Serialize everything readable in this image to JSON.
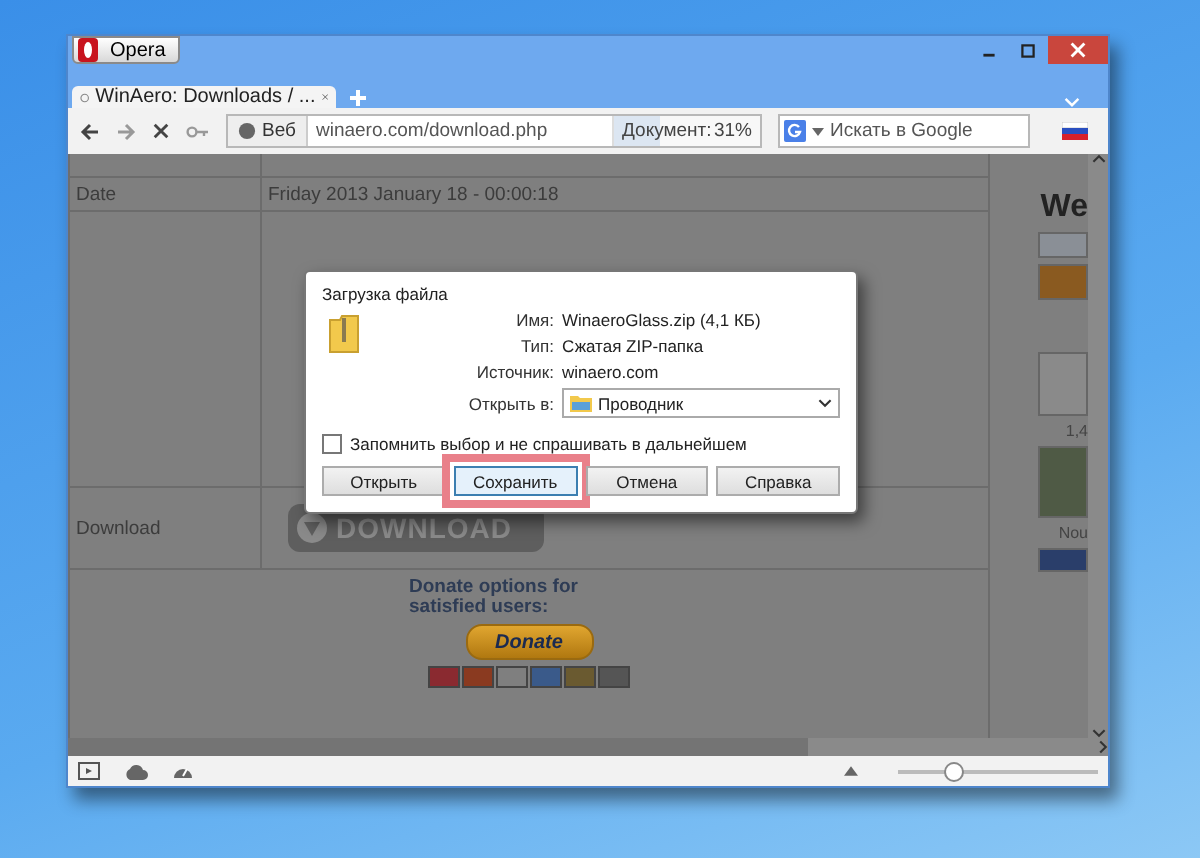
{
  "window": {
    "menu_button": "Opera"
  },
  "tabs": [
    {
      "label": "WinAero: Downloads / ...",
      "selected": true
    }
  ],
  "toolbar": {
    "address_badge": "Веб",
    "url": "winaero.com/download.php",
    "progress_label": "Документ:",
    "progress_reading": "31%",
    "progress": {
      "level": 0.31
    },
    "search": {
      "placeholder": "Искать в Google"
    }
  },
  "page": {
    "rows": [
      {
        "label": "Date",
        "value": "Friday 2013 January 18 - 00:00:18"
      },
      {
        "label": "Download",
        "button": "DOWNLOAD"
      }
    ],
    "donate_text": "Donate options for satisfied users:",
    "donate_button": "Donate",
    "sidebar": {
      "heading": "We",
      "count": "1,4",
      "caption": "Nou"
    }
  },
  "dialog": {
    "title": "Загрузка файла",
    "fields": [
      {
        "label": "Имя:",
        "value": "WinaeroGlass.zip (4,1 КБ)"
      },
      {
        "label": "Тип:",
        "value": "Сжатая ZIP-папка"
      },
      {
        "label": "Источник:",
        "value": "winaero.com"
      }
    ],
    "open_with": {
      "label": "Открыть в:",
      "value": "Проводник"
    },
    "remember": {
      "label": "Запомнить выбор и не спрашивать в дальнейшем",
      "checked": false
    },
    "buttons": [
      {
        "label": "Открыть",
        "selected": false
      },
      {
        "label": "Сохранить",
        "selected": true
      },
      {
        "label": "Отмена",
        "selected": false
      },
      {
        "label": "Справка",
        "selected": false
      }
    ]
  },
  "status_bar": {
    "zoom": {
      "level": 0.28
    }
  }
}
